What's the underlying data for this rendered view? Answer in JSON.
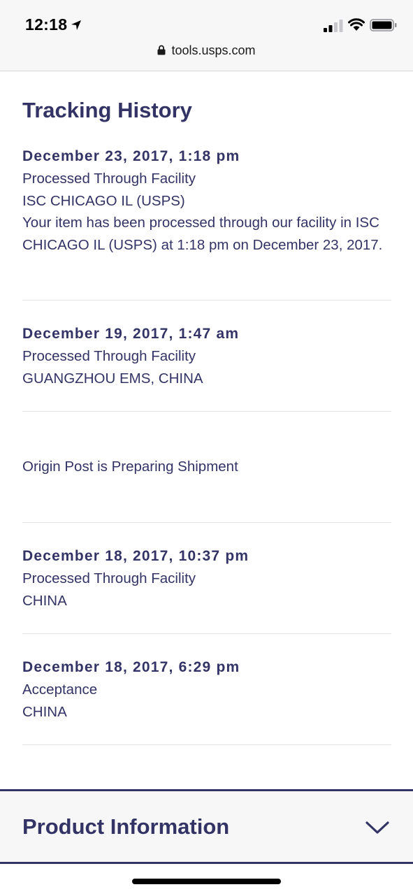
{
  "status_bar": {
    "time": "12:18",
    "icons": [
      "location-arrow-icon",
      "cellular-signal-icon",
      "wifi-icon",
      "battery-icon"
    ]
  },
  "browser": {
    "url": "tools.usps.com",
    "icons": [
      "lock-icon"
    ]
  },
  "tracking": {
    "title": "Tracking History",
    "events": [
      {
        "date": "December 23, 2017, 1:18 pm",
        "status": "Processed Through Facility",
        "location": "ISC CHICAGO IL (USPS)",
        "detail": "Your item has been processed through our facility in ISC CHICAGO IL (USPS) at 1:18 pm on December 23, 2017."
      },
      {
        "date": "December 19, 2017, 1:47 am",
        "status": "Processed Through Facility",
        "location": "GUANGZHOU EMS, CHINA"
      },
      {
        "status": "Origin Post is Preparing Shipment"
      },
      {
        "date": "December 18, 2017, 10:37 pm",
        "status": "Processed Through Facility",
        "location": "CHINA"
      },
      {
        "date": "December 18, 2017, 6:29 pm",
        "status": "Acceptance",
        "location": "CHINA"
      }
    ]
  },
  "product": {
    "title": "Product Information",
    "icon": "chevron-down-icon"
  },
  "colors": {
    "brand_navy": "#333366",
    "divider": "#e3e3e6",
    "chrome_bg": "#f7f7f8"
  }
}
